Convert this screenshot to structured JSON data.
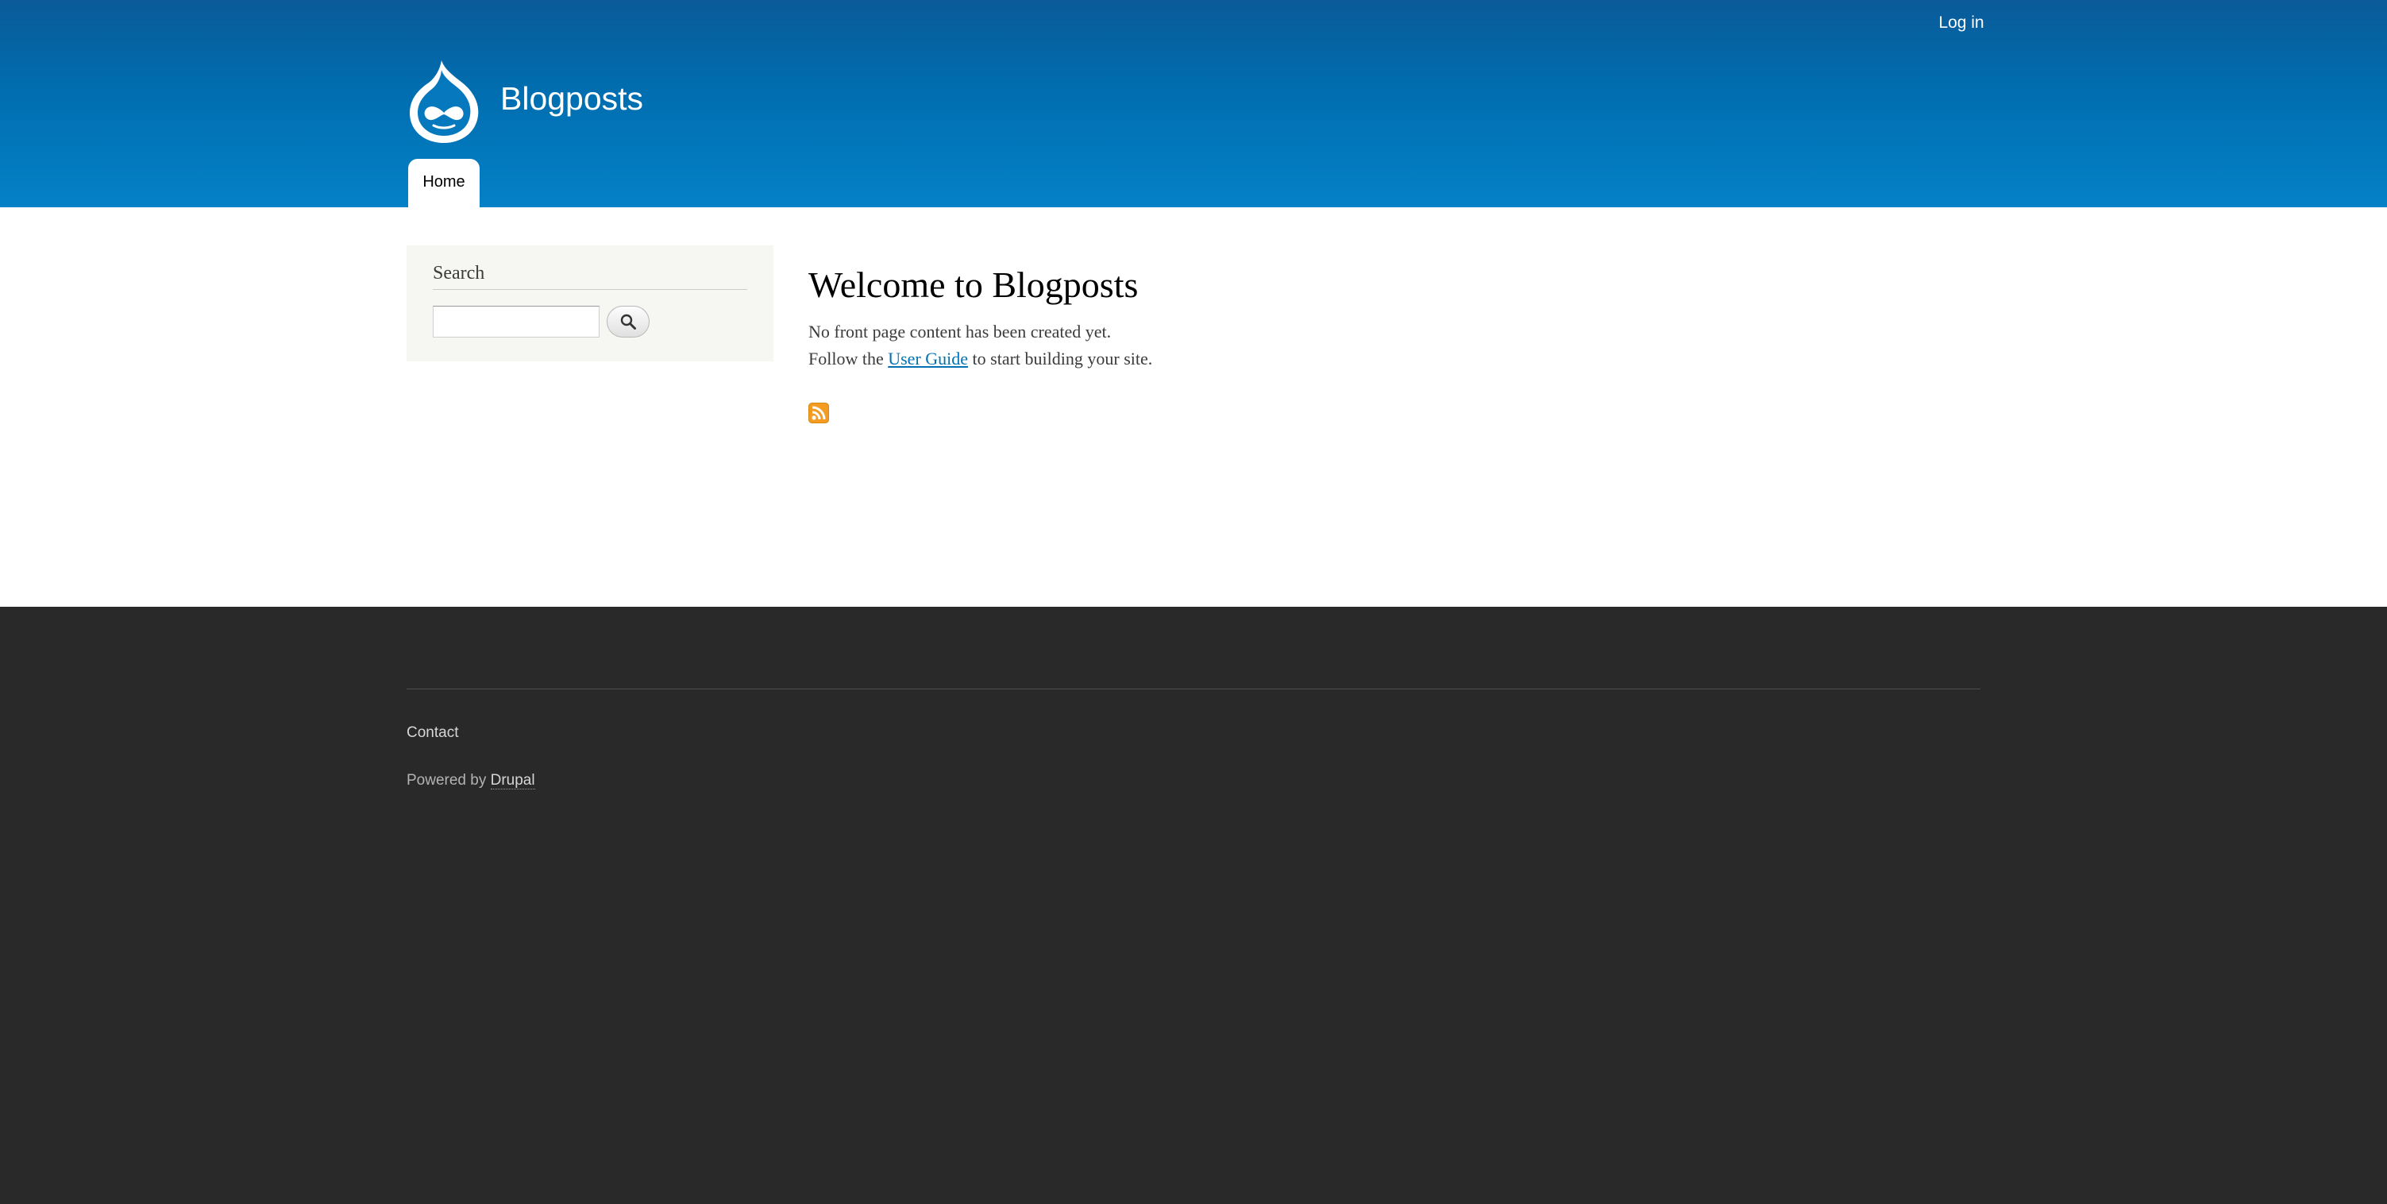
{
  "header": {
    "login_label": "Log in",
    "site_name": "Blogposts",
    "logo_icon": "drupal-drop-icon",
    "gradient_top": "#0a5b98",
    "gradient_bottom": "#0581c7"
  },
  "nav": {
    "tabs": [
      {
        "label": "Home",
        "active": true
      }
    ]
  },
  "sidebar": {
    "search_block": {
      "title": "Search",
      "input_value": "",
      "button_icon": "search-icon"
    }
  },
  "content": {
    "title": "Welcome to Blogposts",
    "line1": "No front page content has been created yet.",
    "line2_before": "Follow the ",
    "line2_link": "User Guide",
    "line2_after": " to start building your site.",
    "feed_icon": "rss-feed-icon",
    "link_color": "#0071b3",
    "feed_color": "#f39c21"
  },
  "footer": {
    "contact_label": "Contact",
    "powered_by": "Powered by ",
    "powered_link": "Drupal",
    "background": "#292929"
  }
}
